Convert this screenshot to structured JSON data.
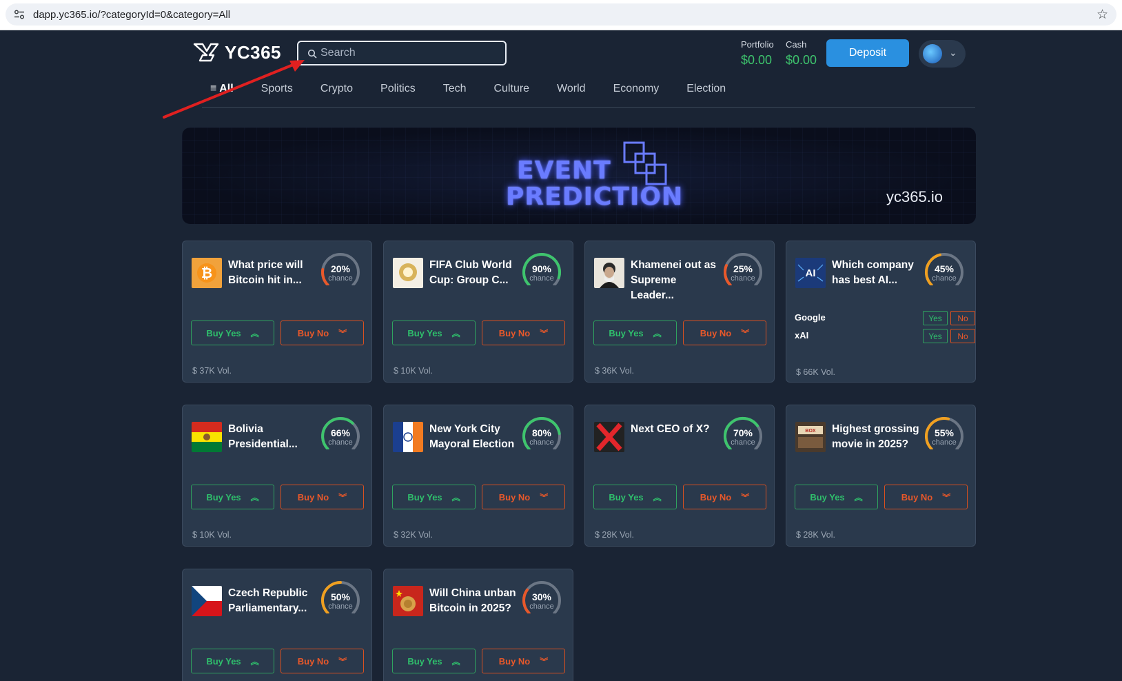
{
  "browser": {
    "url": "dapp.yc365.io/?categoryId=0&category=All"
  },
  "header": {
    "logo_text": "YC365",
    "search_placeholder": "Search",
    "portfolio_label": "Portfolio",
    "portfolio_value": "$0.00",
    "cash_label": "Cash",
    "cash_value": "$0.00",
    "deposit_label": "Deposit"
  },
  "nav": {
    "items": [
      "≡ All",
      "Sports",
      "Crypto",
      "Politics",
      "Tech",
      "Culture",
      "World",
      "Economy",
      "Election"
    ],
    "active_index": 0
  },
  "banner": {
    "line1": "EVENT",
    "line2": "PREDICTION",
    "site": "yc365.io"
  },
  "cards": [
    {
      "title": "What price will Bitcoin hit in...",
      "percent": "20%",
      "value": 20,
      "chance": "chance",
      "buy_yes": "Buy Yes",
      "buy_no": "Buy No",
      "volume": "$ 37K Vol.",
      "thumb": "bitcoin"
    },
    {
      "title": "FIFA Club World Cup: Group C...",
      "percent": "90%",
      "value": 90,
      "chance": "chance",
      "buy_yes": "Buy Yes",
      "buy_no": "Buy No",
      "volume": "$ 10K Vol.",
      "thumb": "fifa"
    },
    {
      "title": "Khamenei out as Supreme Leader...",
      "percent": "25%",
      "value": 25,
      "chance": "chance",
      "buy_yes": "Buy Yes",
      "buy_no": "Buy No",
      "volume": "$ 36K Vol.",
      "thumb": "portrait"
    },
    {
      "title": "Which company has best AI...",
      "percent": "45%",
      "value": 45,
      "chance": "chance",
      "volume": "$ 66K Vol.",
      "thumb": "ai",
      "options": [
        {
          "name": "Google",
          "yes": "Yes",
          "no": "No"
        },
        {
          "name": "xAI",
          "yes": "Yes",
          "no": "No"
        }
      ]
    },
    {
      "title": "Bolivia Presidential...",
      "percent": "66%",
      "value": 66,
      "chance": "chance",
      "buy_yes": "Buy Yes",
      "buy_no": "Buy No",
      "volume": "$ 10K Vol.",
      "thumb": "bolivia"
    },
    {
      "title": "New York City Mayoral Election",
      "percent": "80%",
      "value": 80,
      "chance": "chance",
      "buy_yes": "Buy Yes",
      "buy_no": "Buy No",
      "volume": "$ 32K Vol.",
      "thumb": "nyc"
    },
    {
      "title": "Next CEO of X?",
      "percent": "70%",
      "value": 70,
      "chance": "chance",
      "buy_yes": "Buy Yes",
      "buy_no": "Buy No",
      "volume": "$ 28K Vol.",
      "thumb": "x"
    },
    {
      "title": "Highest grossing movie in 2025?",
      "percent": "55%",
      "value": 55,
      "chance": "chance",
      "buy_yes": "Buy Yes",
      "buy_no": "Buy No",
      "volume": "$ 28K Vol.",
      "thumb": "boxoffice"
    },
    {
      "title": "Czech Republic Parliamentary...",
      "percent": "50%",
      "value": 50,
      "chance": "chance",
      "buy_yes": "Buy Yes",
      "buy_no": "Buy No",
      "volume": "",
      "thumb": "czech"
    },
    {
      "title": "Will China unban Bitcoin in 2025?",
      "percent": "30%",
      "value": 30,
      "chance": "chance",
      "buy_yes": "Buy Yes",
      "buy_no": "Buy No",
      "volume": "",
      "thumb": "china"
    }
  ],
  "colors": {
    "green": "#3ec46d",
    "red": "#e8582a",
    "orange": "#f0a020",
    "accent": "#2a90e0"
  }
}
